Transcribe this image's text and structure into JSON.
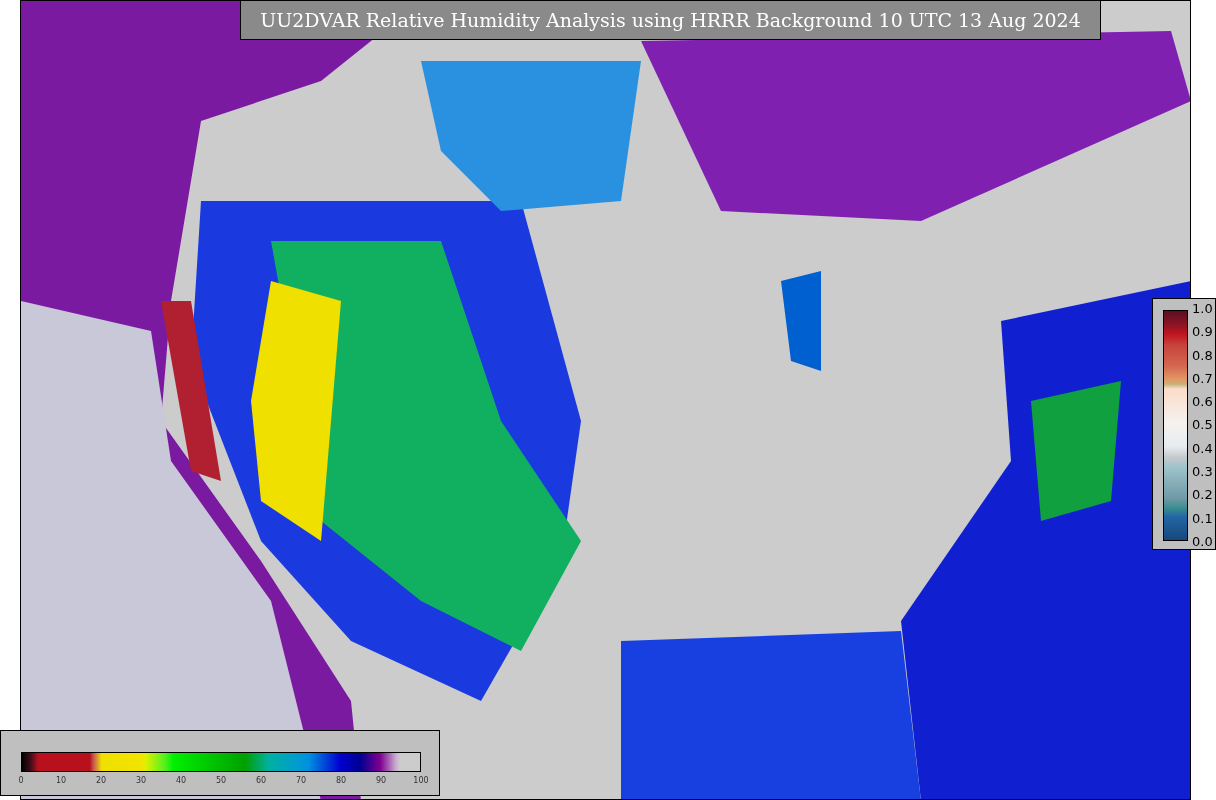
{
  "title": "UU2DVAR Relative Humidity Analysis using HRRR Background 10 UTC 13 Aug 2024",
  "humidity_colorbar": {
    "ticks": [
      "0",
      "10",
      "20",
      "30",
      "40",
      "50",
      "60",
      "70",
      "80",
      "90",
      "100"
    ]
  },
  "observation_colorbar": {
    "ticks": [
      "1.0",
      "0.9",
      "0.8",
      "0.7",
      "0.6",
      "0.5",
      "0.4",
      "0.3",
      "0.2",
      "0.1",
      "0.0"
    ]
  }
}
